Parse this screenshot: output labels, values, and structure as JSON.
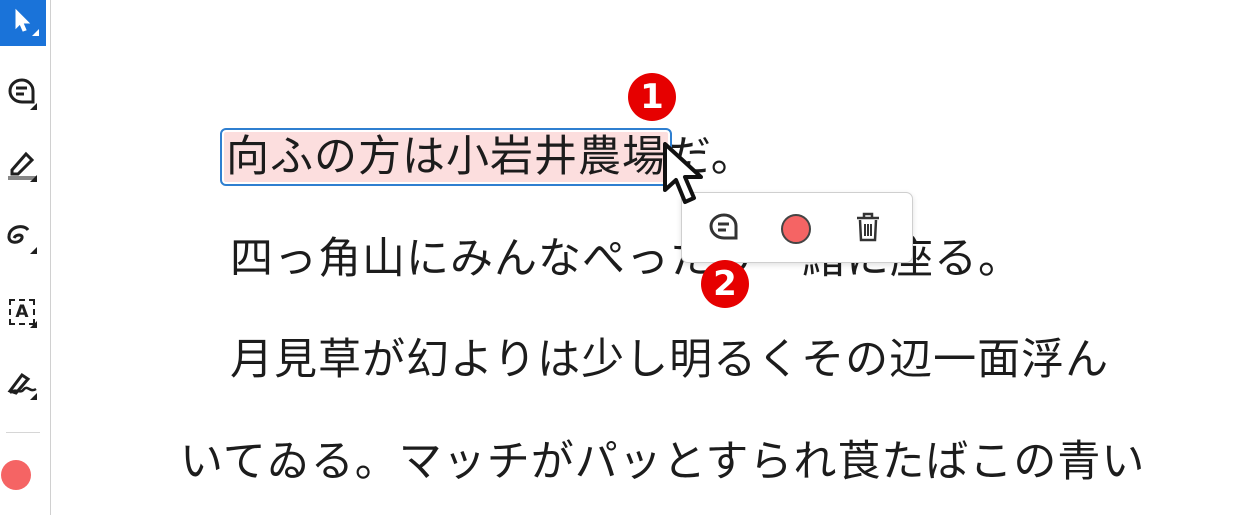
{
  "toolbar": {
    "tools": [
      {
        "name": "select-tool",
        "icon": "cursor-arrow-icon",
        "active": true
      },
      {
        "name": "comment-tool",
        "icon": "comment-bubble-icon"
      },
      {
        "name": "highlight-tool",
        "icon": "highlighter-icon"
      },
      {
        "name": "freehand-tool",
        "icon": "freehand-draw-icon"
      },
      {
        "name": "textbox-tool",
        "icon": "text-box-icon",
        "glyph": "A"
      },
      {
        "name": "signature-tool",
        "icon": "signature-pen-icon"
      }
    ],
    "current_color": "#f56464"
  },
  "document": {
    "lines": [
      {
        "highlighted": "向ふの方は小岩井農場",
        "rest": "だ。"
      },
      {
        "text": "四っ角山にみんなぺったり一緒に座る。"
      },
      {
        "text": "月見草が幻よりは少し明るくその辺一面浮ん"
      },
      {
        "text": "いてゐる。マッチがパッとすられ莨たばこの青い"
      }
    ],
    "highlight_color": "#fcdede",
    "selection_border_color": "#2f7fd0"
  },
  "popup": {
    "buttons": [
      {
        "name": "add-comment-button",
        "icon": "comment-bubble-icon"
      },
      {
        "name": "color-picker-button",
        "icon": "color-dot-icon",
        "color": "#f56464"
      },
      {
        "name": "delete-button",
        "icon": "trash-icon"
      }
    ]
  },
  "callouts": [
    {
      "label": "1"
    },
    {
      "label": "2"
    }
  ],
  "colors": {
    "accent": "#1a73d9",
    "callout": "#e60000"
  }
}
